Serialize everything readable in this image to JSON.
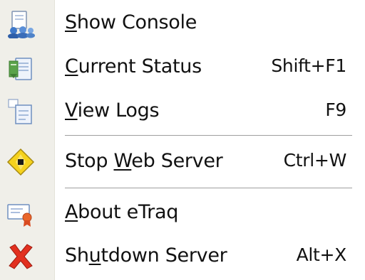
{
  "menu": {
    "items": [
      {
        "pre": "",
        "mn": "S",
        "post": "how Console",
        "shortcut": "",
        "icon": "console-users-icon"
      },
      {
        "pre": "",
        "mn": "C",
        "post": "urrent Status",
        "shortcut": "Shift+F1",
        "icon": "status-document-icon"
      },
      {
        "pre": "",
        "mn": "V",
        "post": "iew Logs",
        "shortcut": "F9",
        "icon": "logs-document-icon"
      },
      {
        "pre": "Stop ",
        "mn": "W",
        "post": "eb Server",
        "shortcut": "Ctrl+W",
        "icon": "stop-diamond-icon"
      },
      {
        "pre": "",
        "mn": "A",
        "post": "bout eTraq",
        "shortcut": "",
        "icon": "about-certificate-icon"
      },
      {
        "pre": "Sh",
        "mn": "u",
        "post": "tdown Server",
        "shortcut": "Alt+X",
        "icon": "shutdown-x-icon"
      }
    ]
  },
  "colors": {
    "gutter": "#f0efe9",
    "separator": "#9f9f9f",
    "text": "#111111",
    "shutdown_red": "#e2301f",
    "stop_yellow": "#f6d21d"
  }
}
